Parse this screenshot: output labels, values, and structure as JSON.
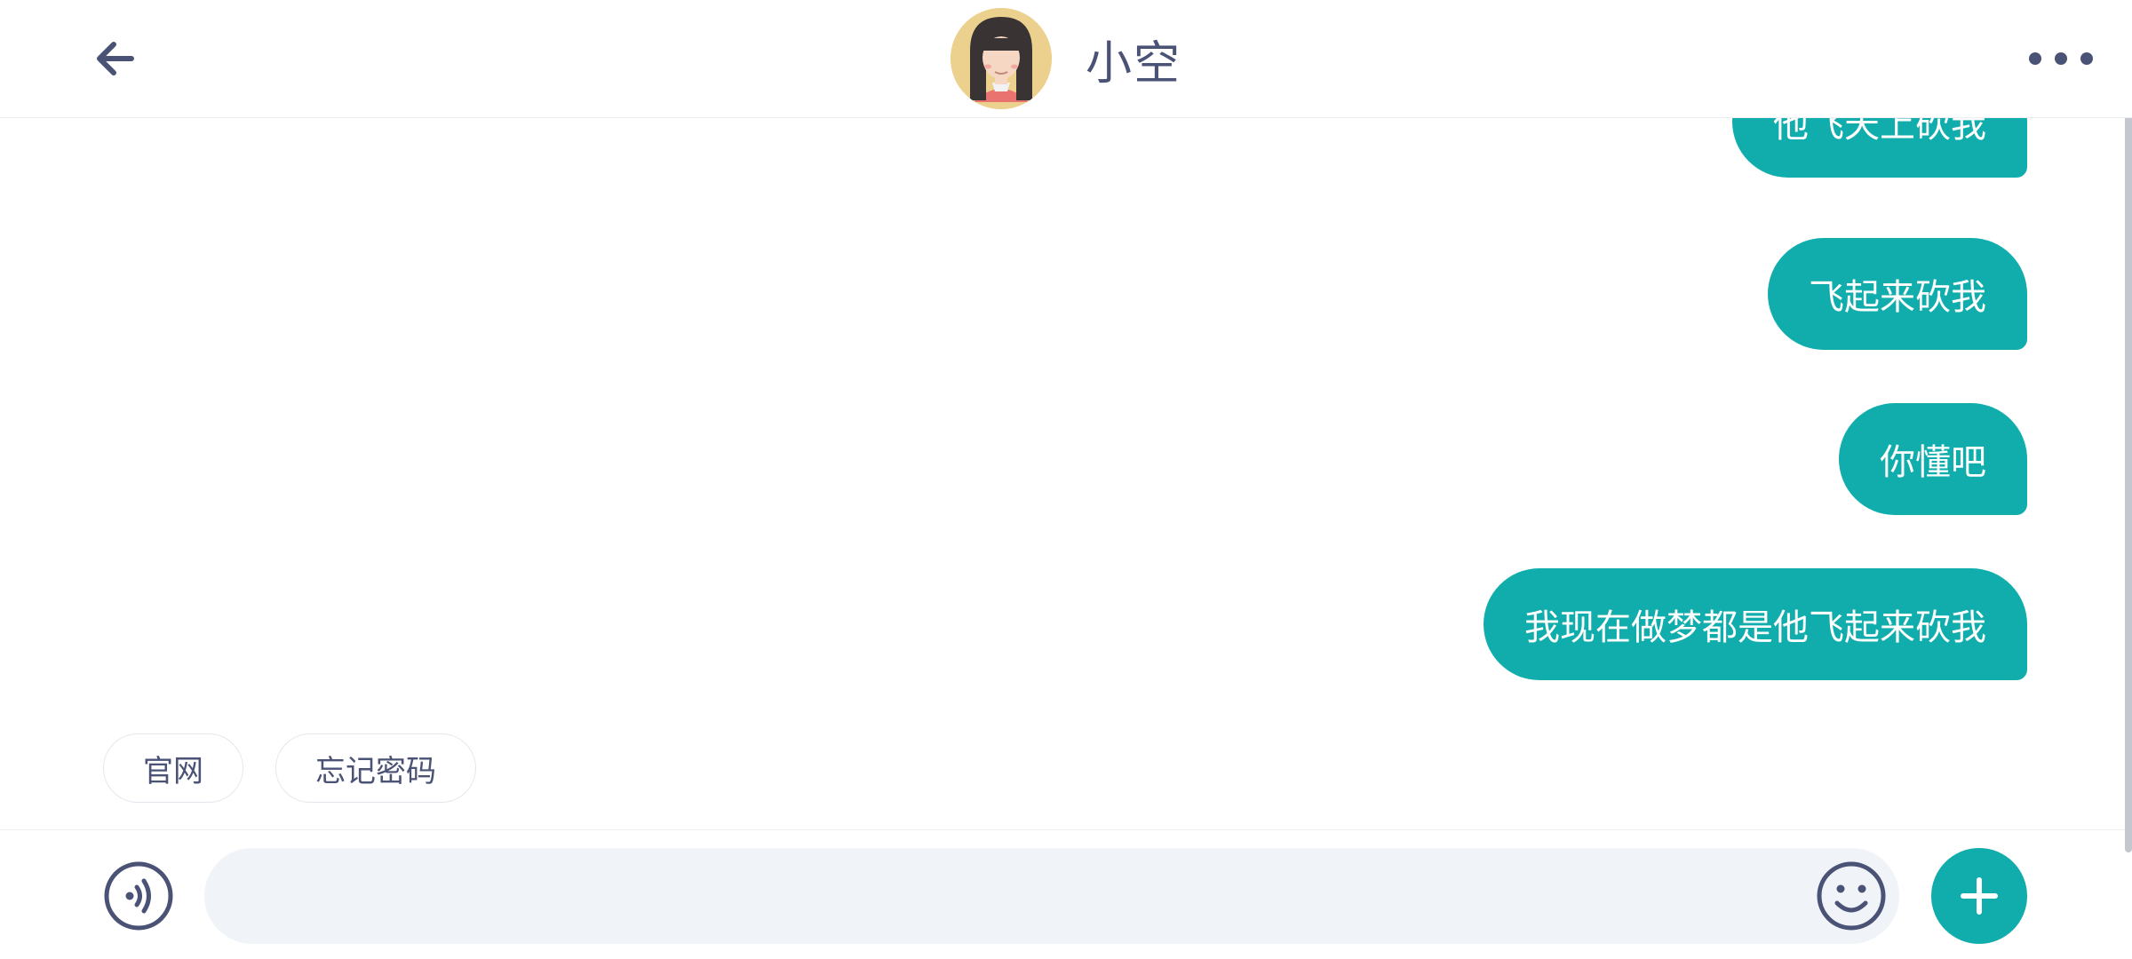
{
  "header": {
    "contact_name": "小空",
    "icons": {
      "back": "arrow-left-icon",
      "more": "more-horizontal-icon",
      "avatar": "girl-avatar"
    }
  },
  "messages": [
    {
      "sender": "me",
      "text": "他飞天上砍我"
    },
    {
      "sender": "me",
      "text": "飞起来砍我"
    },
    {
      "sender": "me",
      "text": "你懂吧"
    },
    {
      "sender": "me",
      "text": "我现在做梦都是他飞起来砍我"
    }
  ],
  "quick_replies": [
    {
      "label": "官网"
    },
    {
      "label": "忘记密码"
    }
  ],
  "input_bar": {
    "text_value": "",
    "placeholder": "",
    "icons": {
      "voice": "voice-icon",
      "emoji": "emoji-icon",
      "plus": "plus-icon"
    }
  },
  "colors": {
    "accent": "#11adad",
    "text_primary": "#4a5275",
    "input_bg": "#f0f3f7",
    "avatar_bg": "#ecd08e"
  }
}
